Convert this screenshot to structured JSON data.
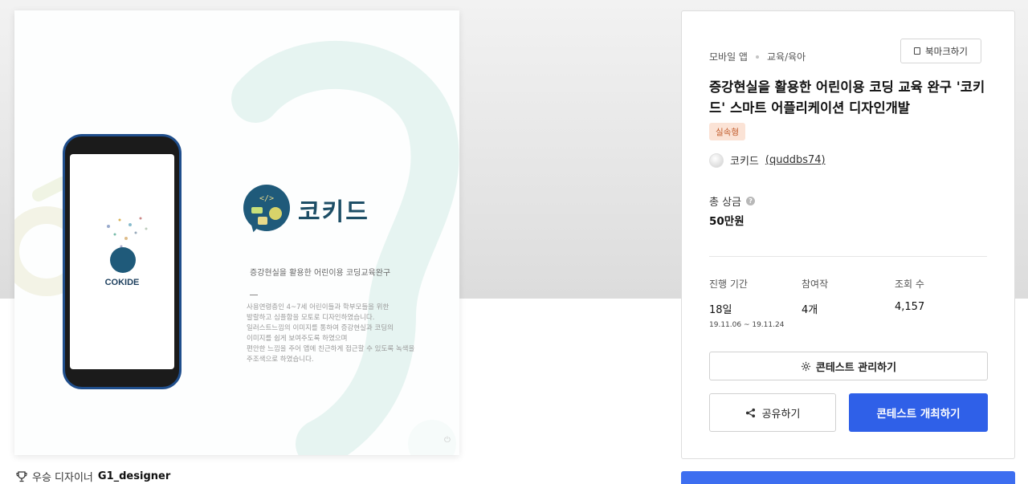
{
  "preview": {
    "brand_name": "코키드",
    "phone_logo_text": "COKIDE",
    "heading": "증강현실을 활용한 어린이용 코딩교육완구",
    "dash": "—",
    "body_lines": [
      "사용연령층인 4~7세 어린이들과 학부모들을 위한",
      "발랄하고 심플함을 모토로 디자인하였습니다.",
      "일러스트느낌의 이미지를 통하여 증강현실과 코딩의",
      "이미지를 쉽게 보여주도록 하였으며",
      "편안한 느낌을 주어 앱에 친근하게 접근할 수 있도록 녹색을",
      "주조색으로 하였습니다."
    ]
  },
  "winner": {
    "label": "우승 디자이너",
    "name": "G1_designer"
  },
  "panel": {
    "category": "모바일 앱",
    "subcategory": "교육/육아",
    "bookmark_label": "북마크하기",
    "title": "증강현실을 활용한 어린이용 코딩 교육 완구 '코키드' 스마트 어플리케이션 디자인개발",
    "tag": "실속형",
    "host_name": "코키드",
    "host_user": "(quddbs74)",
    "prize_label": "총 상금",
    "prize_value": "50만원",
    "stats": {
      "period_label": "진행 기간",
      "period_value": "18일",
      "period_dates": "19.11.06 ~ 19.11.24",
      "entries_label": "참여작",
      "entries_value": "4개",
      "views_label": "조회 수",
      "views_value": "4,157"
    },
    "manage_label": "콘테스트 관리하기",
    "share_label": "공유하기",
    "host_contest_label": "콘테스트 개최하기"
  },
  "colors": {
    "primary": "#2f60e8",
    "tag_bg": "#fbe3d6",
    "tag_text": "#c15a2a",
    "brand_teal": "#1f5a7a"
  }
}
